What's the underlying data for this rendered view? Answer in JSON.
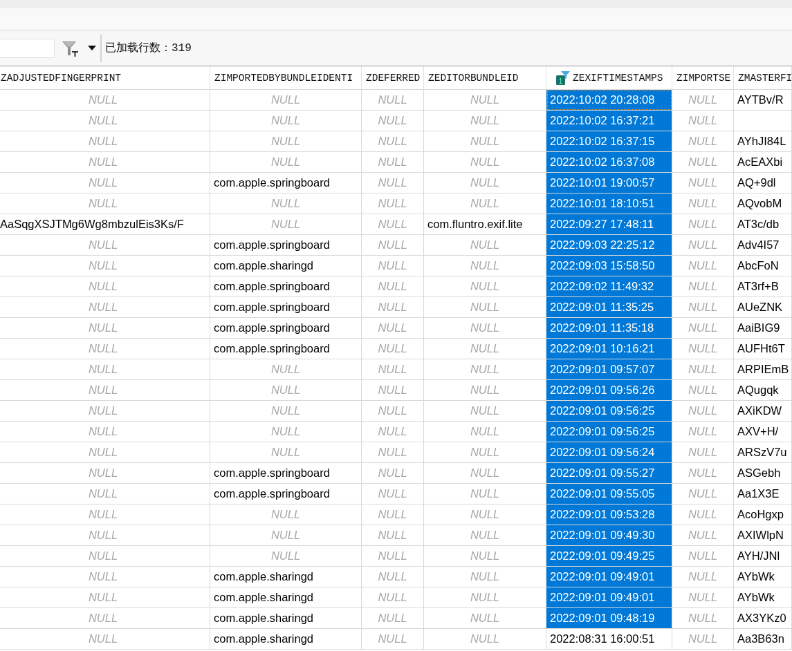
{
  "toolbar": {
    "controls": [
      {
        "kind": "search"
      },
      {
        "kind": "filter"
      },
      {
        "kind": "dropdown"
      }
    ],
    "loaded_rows": "已加载行数：319"
  },
  "table": {
    "columns": [
      {
        "label": "ZADJUSTEDFINGERPRINT"
      },
      {
        "label": "ZIMPORTEDBYBUNDLEIDENTI"
      },
      {
        "label": "ZDEFERRED"
      },
      {
        "label": "ZEDITORBUNDLEID"
      },
      {
        "label": "ZEXIFTIMESTAMPS",
        "sort_badge": "1"
      },
      {
        "label": "ZIMPORTSE"
      },
      {
        "label": "ZMASTERFI"
      }
    ],
    "rows": [
      {
        "cells": [
          {
            "text": "NULL",
            "kind": "null",
            "selected": false,
            "focused": false
          },
          {
            "text": "NULL",
            "kind": "null",
            "selected": false,
            "focused": false
          },
          {
            "text": "NULL",
            "kind": "null",
            "selected": false,
            "focused": false
          },
          {
            "text": "NULL",
            "kind": "null",
            "selected": false,
            "focused": false
          },
          {
            "text": "2022:10:02 20:28:08",
            "kind": "value",
            "selected": true,
            "focused": true
          },
          {
            "text": "NULL",
            "kind": "null",
            "selected": false,
            "focused": false
          },
          {
            "text": "AYTBv/R",
            "kind": "value",
            "selected": false,
            "focused": false
          }
        ]
      },
      {
        "cells": [
          {
            "text": "NULL",
            "kind": "null",
            "selected": false,
            "focused": false
          },
          {
            "text": "NULL",
            "kind": "null",
            "selected": false,
            "focused": false
          },
          {
            "text": "NULL",
            "kind": "null",
            "selected": false,
            "focused": false
          },
          {
            "text": "NULL",
            "kind": "null",
            "selected": false,
            "focused": false
          },
          {
            "text": "2022:10:02 16:37:21",
            "kind": "value",
            "selected": true,
            "focused": false
          },
          {
            "text": "NULL",
            "kind": "null",
            "selected": false,
            "focused": false
          },
          {
            "kind": "empty",
            "selected": false,
            "focused": false
          }
        ]
      },
      {
        "cells": [
          {
            "text": "NULL",
            "kind": "null",
            "selected": false,
            "focused": false
          },
          {
            "text": "NULL",
            "kind": "null",
            "selected": false,
            "focused": false
          },
          {
            "text": "NULL",
            "kind": "null",
            "selected": false,
            "focused": false
          },
          {
            "text": "NULL",
            "kind": "null",
            "selected": false,
            "focused": false
          },
          {
            "text": "2022:10:02 16:37:15",
            "kind": "value",
            "selected": true,
            "focused": false
          },
          {
            "text": "NULL",
            "kind": "null",
            "selected": false,
            "focused": false
          },
          {
            "text": "AYhJI84L",
            "kind": "value",
            "selected": false,
            "focused": false
          }
        ]
      },
      {
        "cells": [
          {
            "text": "NULL",
            "kind": "null",
            "selected": false,
            "focused": false
          },
          {
            "text": "NULL",
            "kind": "null",
            "selected": false,
            "focused": false
          },
          {
            "text": "NULL",
            "kind": "null",
            "selected": false,
            "focused": false
          },
          {
            "text": "NULL",
            "kind": "null",
            "selected": false,
            "focused": false
          },
          {
            "text": "2022:10:02 16:37:08",
            "kind": "value",
            "selected": true,
            "focused": false
          },
          {
            "text": "NULL",
            "kind": "null",
            "selected": false,
            "focused": false
          },
          {
            "text": "AcEAXbi",
            "kind": "value",
            "selected": false,
            "focused": false
          }
        ]
      },
      {
        "cells": [
          {
            "text": "NULL",
            "kind": "null",
            "selected": false,
            "focused": false
          },
          {
            "text": "com.apple.springboard",
            "kind": "value",
            "selected": false,
            "focused": false
          },
          {
            "text": "NULL",
            "kind": "null",
            "selected": false,
            "focused": false
          },
          {
            "text": "NULL",
            "kind": "null",
            "selected": false,
            "focused": false
          },
          {
            "text": "2022:10:01 19:00:57",
            "kind": "value",
            "selected": true,
            "focused": false
          },
          {
            "text": "NULL",
            "kind": "null",
            "selected": false,
            "focused": false
          },
          {
            "text": "AQ+9dl",
            "kind": "value",
            "selected": false,
            "focused": false
          }
        ]
      },
      {
        "cells": [
          {
            "text": "NULL",
            "kind": "null",
            "selected": false,
            "focused": false
          },
          {
            "text": "NULL",
            "kind": "null",
            "selected": false,
            "focused": false
          },
          {
            "text": "NULL",
            "kind": "null",
            "selected": false,
            "focused": false
          },
          {
            "text": "NULL",
            "kind": "null",
            "selected": false,
            "focused": false
          },
          {
            "text": "2022:10:01 18:10:51",
            "kind": "value",
            "selected": true,
            "focused": false
          },
          {
            "text": "NULL",
            "kind": "null",
            "selected": false,
            "focused": false
          },
          {
            "text": "AQvobM",
            "kind": "value",
            "selected": false,
            "focused": false
          }
        ]
      },
      {
        "cells": [
          {
            "text": "AaSqgXSJTMg6Wg8mbzulEis3Ks/F",
            "kind": "value",
            "selected": false,
            "focused": false
          },
          {
            "text": "NULL",
            "kind": "null",
            "selected": false,
            "focused": false
          },
          {
            "text": "NULL",
            "kind": "null",
            "selected": false,
            "focused": false
          },
          {
            "text": "com.fluntro.exif.lite",
            "kind": "value",
            "selected": false,
            "focused": false
          },
          {
            "text": "2022:09:27 17:48:11",
            "kind": "value",
            "selected": true,
            "focused": false
          },
          {
            "text": "NULL",
            "kind": "null",
            "selected": false,
            "focused": false
          },
          {
            "text": "AT3c/db",
            "kind": "value",
            "selected": false,
            "focused": false
          }
        ]
      },
      {
        "cells": [
          {
            "text": "NULL",
            "kind": "null",
            "selected": false,
            "focused": false
          },
          {
            "text": "com.apple.springboard",
            "kind": "value",
            "selected": false,
            "focused": false
          },
          {
            "text": "NULL",
            "kind": "null",
            "selected": false,
            "focused": false
          },
          {
            "text": "NULL",
            "kind": "null",
            "selected": false,
            "focused": false
          },
          {
            "text": "2022:09:03 22:25:12",
            "kind": "value",
            "selected": true,
            "focused": false
          },
          {
            "text": "NULL",
            "kind": "null",
            "selected": false,
            "focused": false
          },
          {
            "text": "Adv4I57",
            "kind": "value",
            "selected": false,
            "focused": false
          }
        ]
      },
      {
        "cells": [
          {
            "text": "NULL",
            "kind": "null",
            "selected": false,
            "focused": false
          },
          {
            "text": "com.apple.sharingd",
            "kind": "value",
            "selected": false,
            "focused": false
          },
          {
            "text": "NULL",
            "kind": "null",
            "selected": false,
            "focused": false
          },
          {
            "text": "NULL",
            "kind": "null",
            "selected": false,
            "focused": false
          },
          {
            "text": "2022:09:03 15:58:50",
            "kind": "value",
            "selected": true,
            "focused": false
          },
          {
            "text": "NULL",
            "kind": "null",
            "selected": false,
            "focused": false
          },
          {
            "text": "AbcFoN",
            "kind": "value",
            "selected": false,
            "focused": false
          }
        ]
      },
      {
        "cells": [
          {
            "text": "NULL",
            "kind": "null",
            "selected": false,
            "focused": false
          },
          {
            "text": "com.apple.springboard",
            "kind": "value",
            "selected": false,
            "focused": false
          },
          {
            "text": "NULL",
            "kind": "null",
            "selected": false,
            "focused": false
          },
          {
            "text": "NULL",
            "kind": "null",
            "selected": false,
            "focused": false
          },
          {
            "text": "2022:09:02 11:49:32",
            "kind": "value",
            "selected": true,
            "focused": false
          },
          {
            "text": "NULL",
            "kind": "null",
            "selected": false,
            "focused": false
          },
          {
            "text": "AT3rf+B",
            "kind": "value",
            "selected": false,
            "focused": false
          }
        ]
      },
      {
        "cells": [
          {
            "text": "NULL",
            "kind": "null",
            "selected": false,
            "focused": false
          },
          {
            "text": "com.apple.springboard",
            "kind": "value",
            "selected": false,
            "focused": false
          },
          {
            "text": "NULL",
            "kind": "null",
            "selected": false,
            "focused": false
          },
          {
            "text": "NULL",
            "kind": "null",
            "selected": false,
            "focused": false
          },
          {
            "text": "2022:09:01 11:35:25",
            "kind": "value",
            "selected": true,
            "focused": false
          },
          {
            "text": "NULL",
            "kind": "null",
            "selected": false,
            "focused": false
          },
          {
            "text": "AUeZNK",
            "kind": "value",
            "selected": false,
            "focused": false
          }
        ]
      },
      {
        "cells": [
          {
            "text": "NULL",
            "kind": "null",
            "selected": false,
            "focused": false
          },
          {
            "text": "com.apple.springboard",
            "kind": "value",
            "selected": false,
            "focused": false
          },
          {
            "text": "NULL",
            "kind": "null",
            "selected": false,
            "focused": false
          },
          {
            "text": "NULL",
            "kind": "null",
            "selected": false,
            "focused": false
          },
          {
            "text": "2022:09:01 11:35:18",
            "kind": "value",
            "selected": true,
            "focused": false
          },
          {
            "text": "NULL",
            "kind": "null",
            "selected": false,
            "focused": false
          },
          {
            "text": "AaiBIG9",
            "kind": "value",
            "selected": false,
            "focused": false
          }
        ]
      },
      {
        "cells": [
          {
            "text": "NULL",
            "kind": "null",
            "selected": false,
            "focused": false
          },
          {
            "text": "com.apple.springboard",
            "kind": "value",
            "selected": false,
            "focused": false
          },
          {
            "text": "NULL",
            "kind": "null",
            "selected": false,
            "focused": false
          },
          {
            "text": "NULL",
            "kind": "null",
            "selected": false,
            "focused": false
          },
          {
            "text": "2022:09:01 10:16:21",
            "kind": "value",
            "selected": true,
            "focused": false
          },
          {
            "text": "NULL",
            "kind": "null",
            "selected": false,
            "focused": false
          },
          {
            "text": "AUFHt6T",
            "kind": "value",
            "selected": false,
            "focused": false
          }
        ]
      },
      {
        "cells": [
          {
            "text": "NULL",
            "kind": "null",
            "selected": false,
            "focused": false
          },
          {
            "text": "NULL",
            "kind": "null",
            "selected": false,
            "focused": false
          },
          {
            "text": "NULL",
            "kind": "null",
            "selected": false,
            "focused": false
          },
          {
            "text": "NULL",
            "kind": "null",
            "selected": false,
            "focused": false
          },
          {
            "text": "2022:09:01 09:57:07",
            "kind": "value",
            "selected": true,
            "focused": false
          },
          {
            "text": "NULL",
            "kind": "null",
            "selected": false,
            "focused": false
          },
          {
            "text": "ARPIEmB",
            "kind": "value",
            "selected": false,
            "focused": false
          }
        ]
      },
      {
        "cells": [
          {
            "text": "NULL",
            "kind": "null",
            "selected": false,
            "focused": false
          },
          {
            "text": "NULL",
            "kind": "null",
            "selected": false,
            "focused": false
          },
          {
            "text": "NULL",
            "kind": "null",
            "selected": false,
            "focused": false
          },
          {
            "text": "NULL",
            "kind": "null",
            "selected": false,
            "focused": false
          },
          {
            "text": "2022:09:01 09:56:26",
            "kind": "value",
            "selected": true,
            "focused": false
          },
          {
            "text": "NULL",
            "kind": "null",
            "selected": false,
            "focused": false
          },
          {
            "text": "AQugqk",
            "kind": "value",
            "selected": false,
            "focused": false
          }
        ]
      },
      {
        "cells": [
          {
            "text": "NULL",
            "kind": "null",
            "selected": false,
            "focused": false
          },
          {
            "text": "NULL",
            "kind": "null",
            "selected": false,
            "focused": false
          },
          {
            "text": "NULL",
            "kind": "null",
            "selected": false,
            "focused": false
          },
          {
            "text": "NULL",
            "kind": "null",
            "selected": false,
            "focused": false
          },
          {
            "text": "2022:09:01 09:56:25",
            "kind": "value",
            "selected": true,
            "focused": false
          },
          {
            "text": "NULL",
            "kind": "null",
            "selected": false,
            "focused": false
          },
          {
            "text": "AXiKDW",
            "kind": "value",
            "selected": false,
            "focused": false
          }
        ]
      },
      {
        "cells": [
          {
            "text": "NULL",
            "kind": "null",
            "selected": false,
            "focused": false
          },
          {
            "text": "NULL",
            "kind": "null",
            "selected": false,
            "focused": false
          },
          {
            "text": "NULL",
            "kind": "null",
            "selected": false,
            "focused": false
          },
          {
            "text": "NULL",
            "kind": "null",
            "selected": false,
            "focused": false
          },
          {
            "text": "2022:09:01 09:56:25",
            "kind": "value",
            "selected": true,
            "focused": false
          },
          {
            "text": "NULL",
            "kind": "null",
            "selected": false,
            "focused": false
          },
          {
            "text": "AXV+H/",
            "kind": "value",
            "selected": false,
            "focused": false
          }
        ]
      },
      {
        "cells": [
          {
            "text": "NULL",
            "kind": "null",
            "selected": false,
            "focused": false
          },
          {
            "text": "NULL",
            "kind": "null",
            "selected": false,
            "focused": false
          },
          {
            "text": "NULL",
            "kind": "null",
            "selected": false,
            "focused": false
          },
          {
            "text": "NULL",
            "kind": "null",
            "selected": false,
            "focused": false
          },
          {
            "text": "2022:09:01 09:56:24",
            "kind": "value",
            "selected": true,
            "focused": false
          },
          {
            "text": "NULL",
            "kind": "null",
            "selected": false,
            "focused": false
          },
          {
            "text": "ARSzV7u",
            "kind": "value",
            "selected": false,
            "focused": false
          }
        ]
      },
      {
        "cells": [
          {
            "text": "NULL",
            "kind": "null",
            "selected": false,
            "focused": false
          },
          {
            "text": "com.apple.springboard",
            "kind": "value",
            "selected": false,
            "focused": false
          },
          {
            "text": "NULL",
            "kind": "null",
            "selected": false,
            "focused": false
          },
          {
            "text": "NULL",
            "kind": "null",
            "selected": false,
            "focused": false
          },
          {
            "text": "2022:09:01 09:55:27",
            "kind": "value",
            "selected": true,
            "focused": false
          },
          {
            "text": "NULL",
            "kind": "null",
            "selected": false,
            "focused": false
          },
          {
            "text": "ASGebh",
            "kind": "value",
            "selected": false,
            "focused": false
          }
        ]
      },
      {
        "cells": [
          {
            "text": "NULL",
            "kind": "null",
            "selected": false,
            "focused": false
          },
          {
            "text": "com.apple.springboard",
            "kind": "value",
            "selected": false,
            "focused": false
          },
          {
            "text": "NULL",
            "kind": "null",
            "selected": false,
            "focused": false
          },
          {
            "text": "NULL",
            "kind": "null",
            "selected": false,
            "focused": false
          },
          {
            "text": "2022:09:01 09:55:05",
            "kind": "value",
            "selected": true,
            "focused": false
          },
          {
            "text": "NULL",
            "kind": "null",
            "selected": false,
            "focused": false
          },
          {
            "text": "Aa1X3E",
            "kind": "value",
            "selected": false,
            "focused": false
          }
        ]
      },
      {
        "cells": [
          {
            "text": "NULL",
            "kind": "null",
            "selected": false,
            "focused": false
          },
          {
            "text": "NULL",
            "kind": "null",
            "selected": false,
            "focused": false
          },
          {
            "text": "NULL",
            "kind": "null",
            "selected": false,
            "focused": false
          },
          {
            "text": "NULL",
            "kind": "null",
            "selected": false,
            "focused": false
          },
          {
            "text": "2022:09:01 09:53:28",
            "kind": "value",
            "selected": true,
            "focused": false
          },
          {
            "text": "NULL",
            "kind": "null",
            "selected": false,
            "focused": false
          },
          {
            "text": "AcoHgxp",
            "kind": "value",
            "selected": false,
            "focused": false
          }
        ]
      },
      {
        "cells": [
          {
            "text": "NULL",
            "kind": "null",
            "selected": false,
            "focused": false
          },
          {
            "text": "NULL",
            "kind": "null",
            "selected": false,
            "focused": false
          },
          {
            "text": "NULL",
            "kind": "null",
            "selected": false,
            "focused": false
          },
          {
            "text": "NULL",
            "kind": "null",
            "selected": false,
            "focused": false
          },
          {
            "text": "2022:09:01 09:49:30",
            "kind": "value",
            "selected": true,
            "focused": false
          },
          {
            "text": "NULL",
            "kind": "null",
            "selected": false,
            "focused": false
          },
          {
            "text": "AXIWlpN",
            "kind": "value",
            "selected": false,
            "focused": false
          }
        ]
      },
      {
        "cells": [
          {
            "text": "NULL",
            "kind": "null",
            "selected": false,
            "focused": false
          },
          {
            "text": "NULL",
            "kind": "null",
            "selected": false,
            "focused": false
          },
          {
            "text": "NULL",
            "kind": "null",
            "selected": false,
            "focused": false
          },
          {
            "text": "NULL",
            "kind": "null",
            "selected": false,
            "focused": false
          },
          {
            "text": "2022:09:01 09:49:25",
            "kind": "value",
            "selected": true,
            "focused": false
          },
          {
            "text": "NULL",
            "kind": "null",
            "selected": false,
            "focused": false
          },
          {
            "text": "AYH/JNl",
            "kind": "value",
            "selected": false,
            "focused": false
          }
        ]
      },
      {
        "cells": [
          {
            "text": "NULL",
            "kind": "null",
            "selected": false,
            "focused": false
          },
          {
            "text": "com.apple.sharingd",
            "kind": "value",
            "selected": false,
            "focused": false
          },
          {
            "text": "NULL",
            "kind": "null",
            "selected": false,
            "focused": false
          },
          {
            "text": "NULL",
            "kind": "null",
            "selected": false,
            "focused": false
          },
          {
            "text": "2022:09:01 09:49:01",
            "kind": "value",
            "selected": true,
            "focused": false
          },
          {
            "text": "NULL",
            "kind": "null",
            "selected": false,
            "focused": false
          },
          {
            "text": "AYbWk",
            "kind": "value",
            "selected": false,
            "focused": false
          }
        ]
      },
      {
        "cells": [
          {
            "text": "NULL",
            "kind": "null",
            "selected": false,
            "focused": false
          },
          {
            "text": "com.apple.sharingd",
            "kind": "value",
            "selected": false,
            "focused": false
          },
          {
            "text": "NULL",
            "kind": "null",
            "selected": false,
            "focused": false
          },
          {
            "text": "NULL",
            "kind": "null",
            "selected": false,
            "focused": false
          },
          {
            "text": "2022:09:01 09:49:01",
            "kind": "value",
            "selected": true,
            "focused": false
          },
          {
            "text": "NULL",
            "kind": "null",
            "selected": false,
            "focused": false
          },
          {
            "text": "AYbWk",
            "kind": "value",
            "selected": false,
            "focused": false
          }
        ]
      },
      {
        "cells": [
          {
            "text": "NULL",
            "kind": "null",
            "selected": false,
            "focused": false
          },
          {
            "text": "com.apple.sharingd",
            "kind": "value",
            "selected": false,
            "focused": false
          },
          {
            "text": "NULL",
            "kind": "null",
            "selected": false,
            "focused": false
          },
          {
            "text": "NULL",
            "kind": "null",
            "selected": false,
            "focused": false
          },
          {
            "text": "2022:09:01 09:48:19",
            "kind": "value",
            "selected": true,
            "focused": false
          },
          {
            "text": "NULL",
            "kind": "null",
            "selected": false,
            "focused": false
          },
          {
            "text": "AX3YKz0",
            "kind": "value",
            "selected": false,
            "focused": false
          }
        ]
      },
      {
        "cells": [
          {
            "text": "NULL",
            "kind": "null",
            "selected": false,
            "focused": false
          },
          {
            "text": "com.apple.sharingd",
            "kind": "value",
            "selected": false,
            "focused": false
          },
          {
            "text": "NULL",
            "kind": "null",
            "selected": false,
            "focused": false
          },
          {
            "text": "NULL",
            "kind": "null",
            "selected": false,
            "focused": false
          },
          {
            "text": "2022:08:31 16:00:51",
            "kind": "value",
            "selected": false,
            "focused": false
          },
          {
            "text": "NULL",
            "kind": "null",
            "selected": false,
            "focused": false
          },
          {
            "text": "Aa3B63n",
            "kind": "value",
            "selected": false,
            "focused": false
          }
        ]
      }
    ]
  }
}
